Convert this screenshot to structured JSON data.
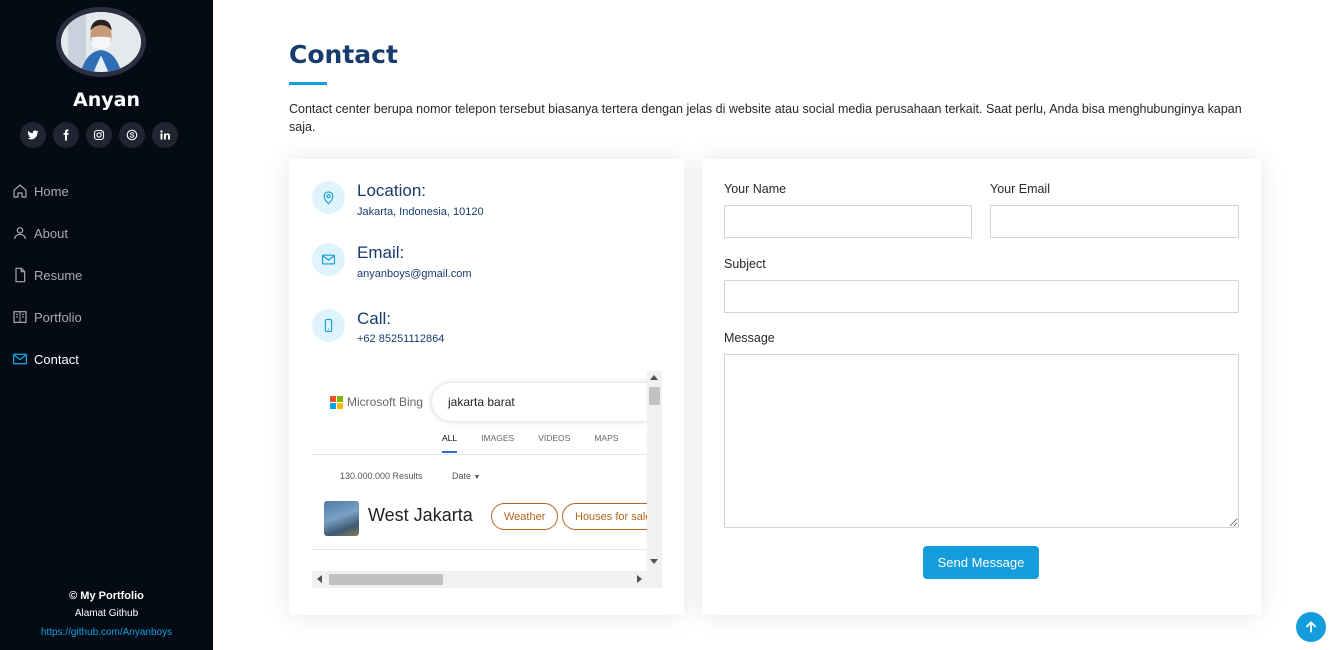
{
  "profile": {
    "name": "Anyan"
  },
  "socials": [
    {
      "icon": "twitter-icon"
    },
    {
      "icon": "facebook-icon"
    },
    {
      "icon": "instagram-icon"
    },
    {
      "icon": "skype-icon"
    },
    {
      "icon": "linkedin-icon"
    }
  ],
  "nav": {
    "home": "Home",
    "about": "About",
    "resume": "Resume",
    "portfolio": "Portfolio",
    "contact": "Contact",
    "active": "contact"
  },
  "footer": {
    "copyright_symbol": "©",
    "copyright_text": "My Portfolio",
    "subtitle": "Alamat Github",
    "link": "https://github.com/Anyanboys"
  },
  "section": {
    "title": "Contact",
    "description": "Contact center berupa nomor telepon tersebut biasanya tertera dengan jelas di website atau social media perusahaan terkait. Saat perlu, Anda bisa menghubunginya kapan saja."
  },
  "info": {
    "location_label": "Location:",
    "location_value": "Jakarta, Indonesia, 10120",
    "email_label": "Email:",
    "email_value": "anyanboys@gmail.com",
    "call_label": "Call:",
    "call_value": "+62 85251112864"
  },
  "map": {
    "brand": "Microsoft Bing",
    "query": "jakarta barat",
    "tabs": [
      "ALL",
      "IMAGES",
      "VIDEOS",
      "MAPS"
    ],
    "results": "130.000.000 Results",
    "date_filter": "Date",
    "place": "West Jakarta",
    "chips": [
      "Weather",
      "Houses for sale"
    ]
  },
  "form": {
    "name_label": "Your Name",
    "email_label": "Your Email",
    "subject_label": "Subject",
    "message_label": "Message",
    "submit": "Send Message"
  },
  "colors": {
    "accent": "#149ddd",
    "sidebar_bg": "#040b14",
    "heading": "#173b6c"
  }
}
